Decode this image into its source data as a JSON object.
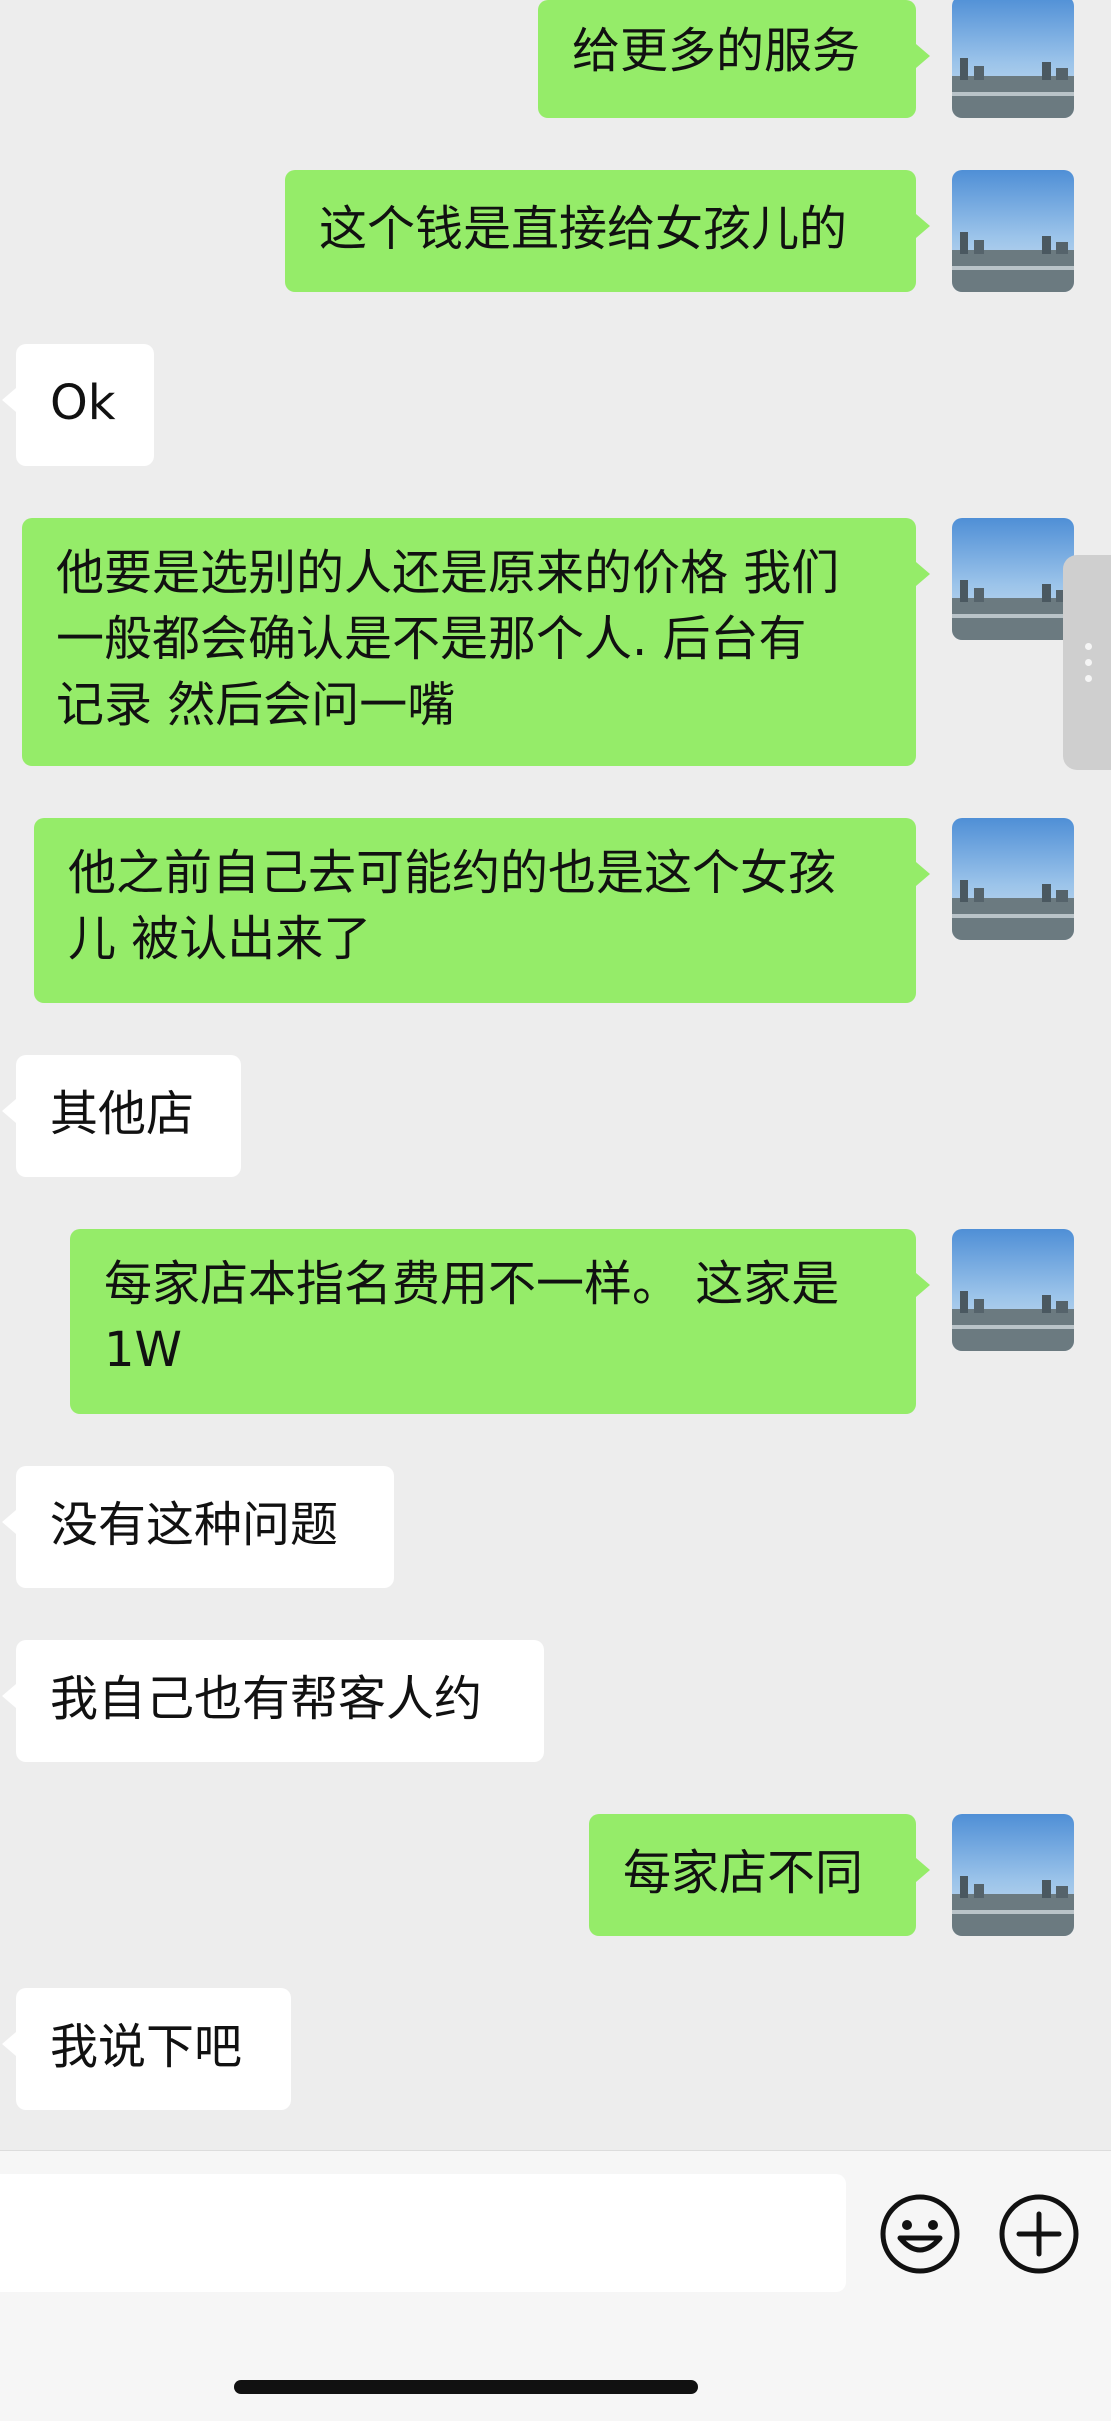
{
  "messages": [
    {
      "sender": "me",
      "text": "给更多的服务"
    },
    {
      "sender": "me",
      "text": "这个钱是直接给女孩儿的"
    },
    {
      "sender": "them",
      "text": "Ok"
    },
    {
      "sender": "me",
      "text": "他要是选别的人还是原来的价格 我们\n一般都会确认是不是那个人. 后台有\n记录 然后会问一嘴"
    },
    {
      "sender": "me",
      "text": "他之前自己去可能约的也是这个女孩\n儿 被认出来了"
    },
    {
      "sender": "them",
      "text": "其他店"
    },
    {
      "sender": "me",
      "text": "每家店本指名费用不一样。 这家是\n1W"
    },
    {
      "sender": "them",
      "text": "没有这种问题"
    },
    {
      "sender": "them",
      "text": "我自己也有帮客人约"
    },
    {
      "sender": "me",
      "text": "每家店不同"
    },
    {
      "sender": "them",
      "text": "我说下吧"
    }
  ],
  "input_bar": {
    "message_value": "",
    "emoji_icon": "emoji-icon",
    "plus_icon": "plus-icon"
  },
  "colors": {
    "background": "#ededed",
    "me_bubble": "#95ec69",
    "them_bubble": "#ffffff"
  }
}
